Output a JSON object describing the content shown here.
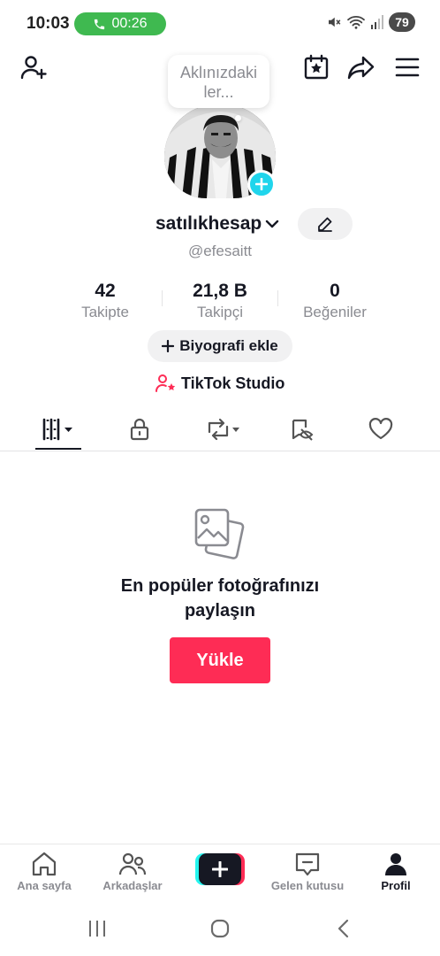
{
  "status_bar": {
    "time": "10:03",
    "call_duration": "00:26",
    "battery": "79"
  },
  "profile": {
    "note_bubble": "Aklınızdaki ler...",
    "username": "satılıkhesap",
    "handle": "@efesaitt",
    "stats": [
      {
        "value": "42",
        "label": "Takipte"
      },
      {
        "value": "21,8 B",
        "label": "Takipçi"
      },
      {
        "value": "0",
        "label": "Beğeniler"
      }
    ],
    "bio_button": "Biyografi ekle",
    "studio_link": "TikTok Studio"
  },
  "tabs": [
    {
      "icon": "grid-icon",
      "active": true
    },
    {
      "icon": "lock-icon",
      "active": false
    },
    {
      "icon": "repost-icon",
      "active": false
    },
    {
      "icon": "tagged-icon",
      "active": false
    },
    {
      "icon": "heart-icon",
      "active": false
    }
  ],
  "empty_state": {
    "title_line1": "En popüler fotoğrafınızı",
    "title_line2": "paylaşın",
    "upload_button": "Yükle"
  },
  "bottom_nav": {
    "home": "Ana sayfa",
    "friends": "Arkadaşlar",
    "inbox": "Gelen kutusu",
    "profile": "Profil"
  },
  "colors": {
    "accent": "#fe2c55",
    "cyan": "#25f4ee",
    "call_green": "#3fb950",
    "text_primary": "#161823",
    "text_secondary": "#8a8b91"
  }
}
